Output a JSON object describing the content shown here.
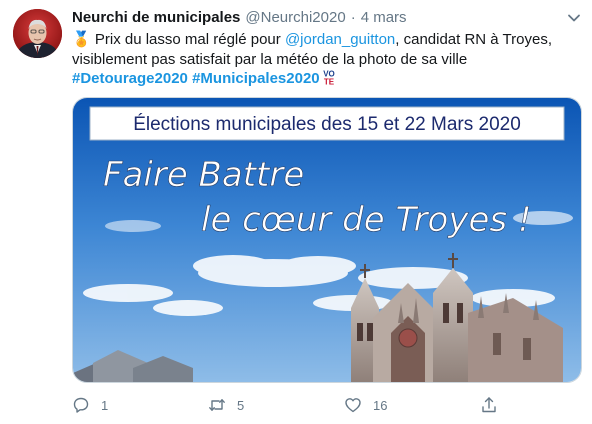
{
  "tweet": {
    "author_name": "Neurchi de municipales",
    "handle": "@Neurchi2020",
    "separator": "·",
    "date": "4 mars",
    "medal_emoji": "🏅",
    "text_1": " Prix du lasso mal réglé pour ",
    "mention": "@jordan_guitton",
    "text_2": ", candidat RN à Troyes,",
    "text_3": "visiblement pas satisfait par la météo de la photo de sa ville",
    "hashtag_1": "#Detourage2020",
    "hashtag_2": "#Municipales2020",
    "vote_emoji_top": "VO",
    "vote_emoji_bottom": "TE"
  },
  "media": {
    "banner_text": "Élections municipales des 15 et 22 Mars 2020",
    "slogan_line1": "Faire Battre",
    "slogan_line2": "le cœur de Troyes !"
  },
  "actions": {
    "reply_count": "1",
    "retweet_count": "5",
    "like_count": "16"
  },
  "icons": {
    "reply": "reply-icon",
    "retweet": "retweet-icon",
    "like": "heart-icon",
    "share": "share-icon",
    "more": "chevron-down-icon"
  },
  "colors": {
    "link": "#1b95e0",
    "muted": "#657786",
    "text": "#14171a"
  }
}
